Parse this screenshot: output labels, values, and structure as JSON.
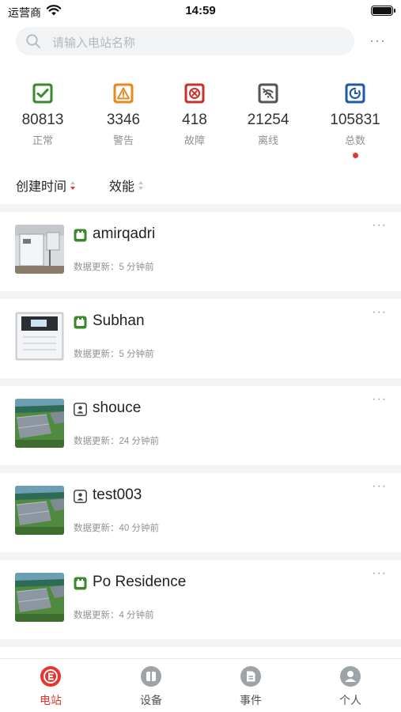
{
  "status_bar": {
    "carrier": "运营商",
    "time": "14:59"
  },
  "search": {
    "placeholder": "请输入电站名称"
  },
  "stats": [
    {
      "value": "80813",
      "label": "正常",
      "icon": "check-icon",
      "color": "#3a8a2c"
    },
    {
      "value": "3346",
      "label": "警告",
      "icon": "warning-icon",
      "color": "#e58a1f"
    },
    {
      "value": "418",
      "label": "故障",
      "icon": "fault-icon",
      "color": "#c9302c"
    },
    {
      "value": "21254",
      "label": "离线",
      "icon": "offline-wifi-icon",
      "color": "#555555"
    },
    {
      "value": "105831",
      "label": "总数",
      "icon": "total-icon",
      "color": "#1f5aa6"
    }
  ],
  "sort": {
    "created_time": "创建时间",
    "efficiency": "效能"
  },
  "stations": [
    {
      "name": "amirqadri",
      "update": "数据更新：5 分钟前",
      "type_icon": "plant-green-icon",
      "thumb": "inverter-photo"
    },
    {
      "name": "Subhan",
      "update": "数据更新：5 分钟前",
      "type_icon": "plant-green-icon",
      "thumb": "inverter-photo"
    },
    {
      "name": "shouce",
      "update": "数据更新：24 分钟前",
      "type_icon": "residential-icon",
      "thumb": "solar-field-photo"
    },
    {
      "name": "test003",
      "update": "数据更新：40 分钟前",
      "type_icon": "residential-icon",
      "thumb": "solar-field-photo"
    },
    {
      "name": "Po Residence",
      "update": "数据更新：4 分钟前",
      "type_icon": "plant-green-icon",
      "thumb": "solar-field-photo"
    }
  ],
  "tabs": [
    {
      "label": "电站",
      "icon": "station-icon",
      "active": true
    },
    {
      "label": "设备",
      "icon": "device-icon",
      "active": false
    },
    {
      "label": "事件",
      "icon": "event-icon",
      "active": false
    },
    {
      "label": "个人",
      "icon": "profile-icon",
      "active": false
    }
  ],
  "colors": {
    "accent": "#e5352f",
    "background_gray": "#f2f3f5"
  }
}
